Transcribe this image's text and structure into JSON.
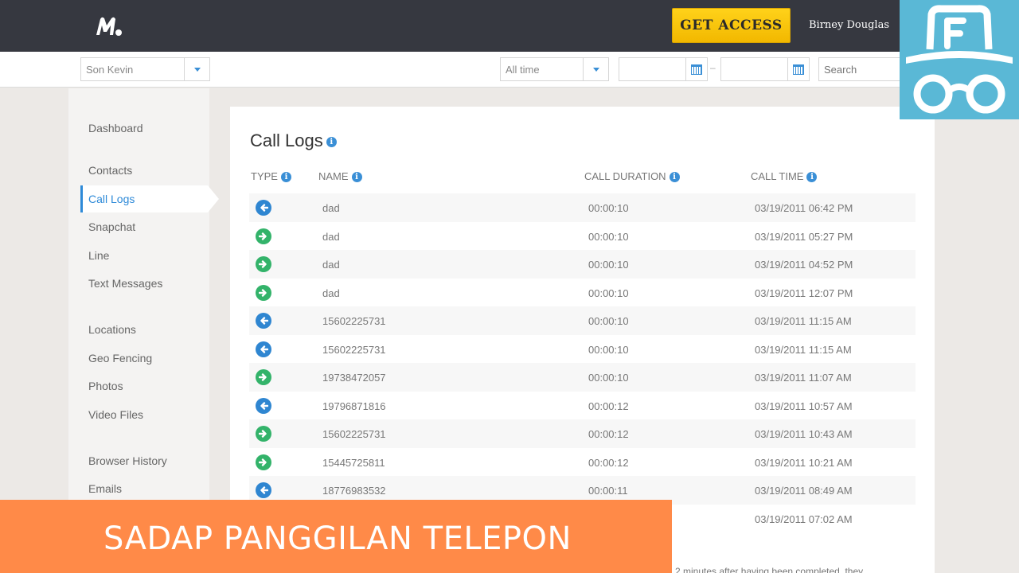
{
  "header": {
    "logo_icon": "mspy-logo-icon",
    "get_access_label": "GET ACCESS",
    "username": "Birney Douglas"
  },
  "filters": {
    "device": "Son Kevin",
    "period": "All time",
    "date_range_separator": "–",
    "search_placeholder": "Search"
  },
  "sidebar": {
    "groups": [
      [
        {
          "label": "Dashboard",
          "active": false
        },
        {
          "label": "Contacts",
          "active": false
        },
        {
          "label": "Call Logs",
          "active": true
        },
        {
          "label": "Snapchat",
          "active": false
        },
        {
          "label": "Line",
          "active": false
        },
        {
          "label": "Text Messages",
          "active": false
        }
      ],
      [
        {
          "label": "Locations",
          "active": false
        },
        {
          "label": "Geo Fencing",
          "active": false
        },
        {
          "label": "Photos",
          "active": false
        },
        {
          "label": "Video Files",
          "active": false
        }
      ],
      [
        {
          "label": "Browser History",
          "active": false
        },
        {
          "label": "Emails",
          "active": false
        }
      ]
    ]
  },
  "main": {
    "title": "Call Logs",
    "columns": {
      "type": "TYPE",
      "name": "NAME",
      "duration": "CALL DURATION",
      "time": "CALL TIME"
    },
    "rows": [
      {
        "type": "incoming",
        "name": "dad",
        "duration": "00:00:10",
        "time": "03/19/2011 06:42 PM"
      },
      {
        "type": "outgoing",
        "name": "dad",
        "duration": "00:00:10",
        "time": "03/19/2011 05:27 PM"
      },
      {
        "type": "outgoing",
        "name": "dad",
        "duration": "00:00:10",
        "time": "03/19/2011 04:52 PM"
      },
      {
        "type": "outgoing",
        "name": "dad",
        "duration": "00:00:10",
        "time": "03/19/2011 12:07 PM"
      },
      {
        "type": "incoming",
        "name": "15602225731",
        "duration": "00:00:10",
        "time": "03/19/2011 11:15 AM"
      },
      {
        "type": "incoming",
        "name": "15602225731",
        "duration": "00:00:10",
        "time": "03/19/2011 11:15 AM"
      },
      {
        "type": "outgoing",
        "name": "19738472057",
        "duration": "00:00:10",
        "time": "03/19/2011 11:07 AM"
      },
      {
        "type": "incoming",
        "name": "19796871816",
        "duration": "00:00:12",
        "time": "03/19/2011 10:57 AM"
      },
      {
        "type": "outgoing",
        "name": "15602225731",
        "duration": "00:00:12",
        "time": "03/19/2011 10:43 AM"
      },
      {
        "type": "outgoing",
        "name": "15445725811",
        "duration": "00:00:12",
        "time": "03/19/2011 10:21 AM"
      },
      {
        "type": "incoming",
        "name": "18776983532",
        "duration": "00:00:11",
        "time": "03/19/2011 08:49 AM"
      },
      {
        "type": "",
        "name": "",
        "duration": "",
        "time": "03/19/2011 07:02 AM"
      }
    ],
    "footnote": "2 minutes after having been completed, they"
  },
  "overlay": {
    "banner_text": "SADAP PANGGILAN TELEPON",
    "badge_icon": "spy-incognito-icon",
    "badge_color": "#5ab8d6",
    "banner_color": "#ff8a48"
  },
  "colors": {
    "accent": "#2e8ad8",
    "incoming": "#2f86d1",
    "outgoing": "#33b36a",
    "cta": "#ffd21a",
    "topbar": "#363840"
  }
}
